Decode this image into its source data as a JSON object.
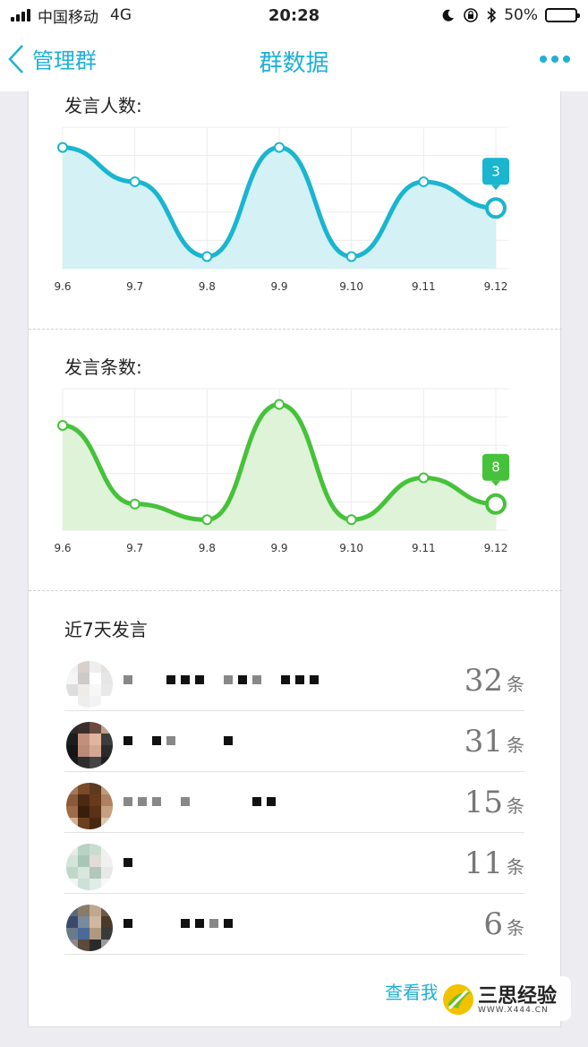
{
  "status_bar": {
    "carrier": "中国移动",
    "network": "4G",
    "time": "20:28",
    "battery": "50%",
    "battery_level": 0.5
  },
  "nav": {
    "back_label": "管理群",
    "title": "群数据"
  },
  "charts_section": {
    "speakers_title": "发言人数:",
    "messages_title": "发言条数:"
  },
  "chart_data": [
    {
      "type": "area",
      "title": "发言人数:",
      "categories": [
        "9.6",
        "9.7",
        "9.8",
        "9.9",
        "9.10",
        "9.11",
        "9.12"
      ],
      "values": [
        6,
        4.3,
        0.6,
        6,
        0.6,
        4.3,
        3
      ],
      "highlight_label": "3",
      "ylim": [
        0,
        7
      ],
      "color": "#1ab5cf",
      "fill": "#d4f1f5",
      "grid": true
    },
    {
      "type": "area",
      "title": "发言条数:",
      "categories": [
        "9.6",
        "9.7",
        "9.8",
        "9.9",
        "9.10",
        "9.11",
        "9.12"
      ],
      "values": [
        20,
        5,
        2,
        24,
        2,
        10,
        5
      ],
      "highlight_label": "8",
      "ylim": [
        0,
        27
      ],
      "color": "#46c23a",
      "fill": "#def3d8",
      "grid": true
    }
  ],
  "ranking": {
    "title": "近7天发言",
    "unit": "条",
    "rows": [
      {
        "count": "32",
        "avatar": [
          "#f2f2f2",
          "#d9d0cc",
          "#eeeeee",
          "#e8e2df",
          "#f5f5f5",
          "#cfcaca",
          "#ffffff",
          "#e6e6e6",
          "#dddddd",
          "#f0ebe8",
          "#f7f7f7",
          "#e9e9e9",
          "#ffffff",
          "#eeeeee",
          "#f3f3f3",
          "#ffffff"
        ]
      },
      {
        "count": "31",
        "avatar": [
          "#2b2b2b",
          "#3a2e2a",
          "#6b4b3f",
          "#bf9f8c",
          "#1d1d1d",
          "#c28f7d",
          "#e2b5a0",
          "#3c3c3c",
          "#151515",
          "#b98a76",
          "#d4a795",
          "#2a2a2a",
          "#1a1a1a",
          "#2e2e2e",
          "#444444",
          "#202020"
        ]
      },
      {
        "count": "15",
        "avatar": [
          "#a07a5a",
          "#7b4a2a",
          "#5b3a20",
          "#c09a7a",
          "#8a5a3a",
          "#4a2a12",
          "#6a3a1a",
          "#b08060",
          "#a06a4a",
          "#3a1e0a",
          "#5a3218",
          "#c8a080",
          "#d0b090",
          "#6a4020",
          "#4a2810",
          "#e0c8b0"
        ]
      },
      {
        "count": "11",
        "avatar": [
          "#e6ece8",
          "#b8d2c4",
          "#c8ddd0",
          "#eef2ef",
          "#d4e4da",
          "#a7c6b4",
          "#e2dcd8",
          "#f0f0f0",
          "#c0d8ca",
          "#d8e6de",
          "#b0c8bc",
          "#e8e8e8",
          "#f4f4f4",
          "#cfe0d6",
          "#e0ece6",
          "#f8f8f8"
        ]
      },
      {
        "count": "6",
        "avatar": [
          "#5a6a7a",
          "#8a7a6a",
          "#c0a890",
          "#6a5a4a",
          "#3a4a6a",
          "#7a8a9a",
          "#d0b8a0",
          "#4a3a2a",
          "#6a7a8a",
          "#4a6a9a",
          "#b09880",
          "#3a3a3a",
          "#8a8a8a",
          "#5a4a3a",
          "#2a2a2a",
          "#9a9a9a"
        ]
      }
    ],
    "view_more": "查看我"
  },
  "watermark": {
    "title": "三思经验",
    "url": "WWW.X444.CN"
  }
}
